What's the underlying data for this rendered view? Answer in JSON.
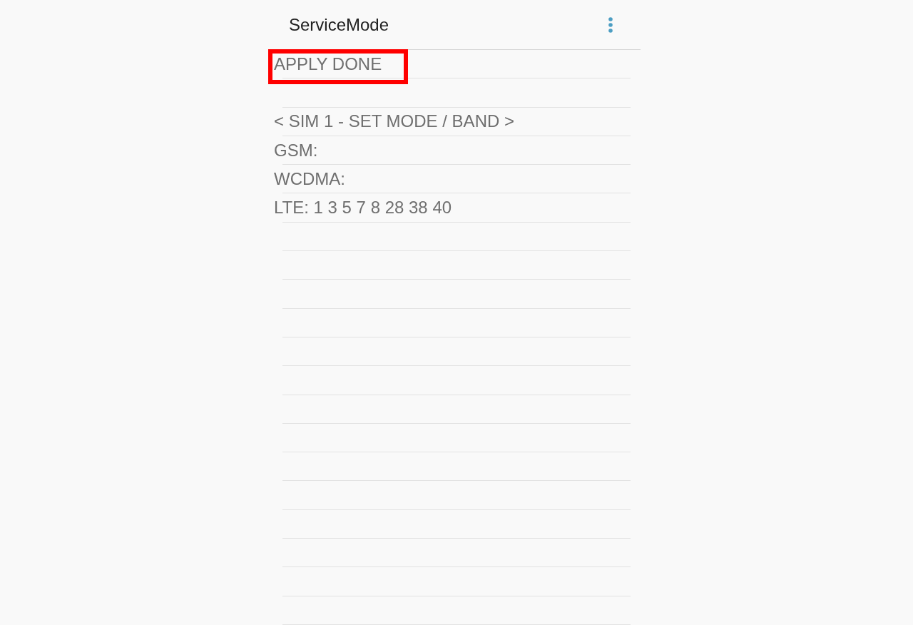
{
  "app_bar": {
    "title": "ServiceMode"
  },
  "rows": [
    {
      "kind": "text",
      "text": "APPLY DONE",
      "highlighted": true
    },
    {
      "kind": "blank"
    },
    {
      "kind": "text",
      "text": "< SIM 1 - SET MODE / BAND >",
      "highlighted": false
    },
    {
      "kind": "text",
      "text": "GSM:",
      "highlighted": false
    },
    {
      "kind": "text",
      "text": "WCDMA:",
      "highlighted": false
    },
    {
      "kind": "text",
      "text": "LTE: 1 3 5 7 8 28 38 40",
      "highlighted": false
    },
    {
      "kind": "blank"
    },
    {
      "kind": "blank"
    },
    {
      "kind": "blank"
    },
    {
      "kind": "blank"
    },
    {
      "kind": "blank"
    },
    {
      "kind": "blank"
    },
    {
      "kind": "blank"
    },
    {
      "kind": "blank"
    },
    {
      "kind": "blank"
    },
    {
      "kind": "blank"
    },
    {
      "kind": "blank"
    },
    {
      "kind": "blank"
    },
    {
      "kind": "blank"
    },
    {
      "kind": "blank"
    }
  ]
}
